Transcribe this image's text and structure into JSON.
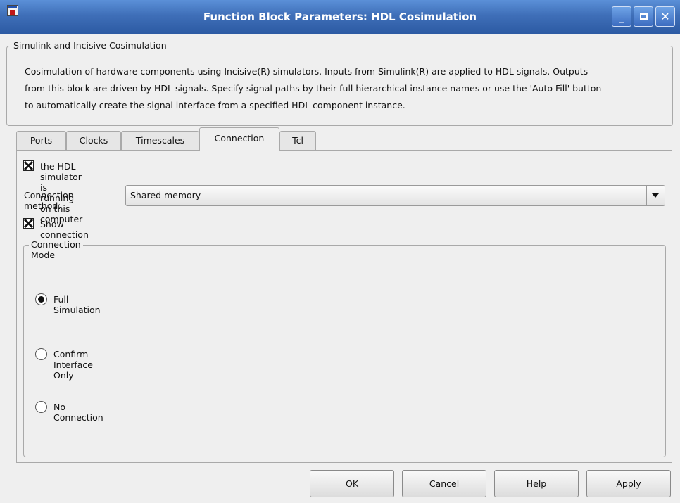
{
  "window": {
    "title": "Function Block Parameters: HDL Cosimulation",
    "app_icon": "simulink-block-icon",
    "controls": {
      "minimize": "minimize-icon",
      "maximize": "maximize-icon",
      "close": "close-icon"
    }
  },
  "description_group": {
    "legend": "Simulink and Incisive Cosimulation",
    "lines": [
      "Cosimulation of hardware components using Incisive(R) simulators.  Inputs from Simulink(R) are applied to HDL signals.  Outputs",
      "from this block are driven by HDL signals.  Specify signal paths by their full hierarchical instance names or use the 'Auto Fill' button",
      "to automatically create the signal interface from a specified HDL component instance."
    ]
  },
  "tabs": [
    {
      "label": "Ports",
      "active": false
    },
    {
      "label": "Clocks",
      "active": false
    },
    {
      "label": "Timescales",
      "active": false
    },
    {
      "label": "Connection",
      "active": true
    },
    {
      "label": "Tcl",
      "active": false
    }
  ],
  "connection": {
    "local_sim": {
      "label": "the HDL simulator is running on this computer",
      "checked": true
    },
    "method": {
      "label": "Connection method:",
      "value": "Shared memory"
    },
    "show_info": {
      "label": "Show connection info on icon",
      "checked": true
    },
    "mode": {
      "legend": "Connection Mode",
      "options": [
        {
          "label": "Full Simulation",
          "selected": true
        },
        {
          "label": "Confirm Interface Only",
          "selected": false
        },
        {
          "label": "No Connection",
          "selected": false
        }
      ]
    }
  },
  "buttons": {
    "ok": {
      "mnemonic": "O",
      "rest": "K"
    },
    "cancel": {
      "mnemonic": "C",
      "rest": "ancel"
    },
    "help": {
      "mnemonic": "H",
      "rest": "elp"
    },
    "apply": {
      "mnemonic": "A",
      "rest": "pply"
    }
  },
  "colors": {
    "titlebar": "#3f6fb8",
    "background": "#efefef"
  }
}
